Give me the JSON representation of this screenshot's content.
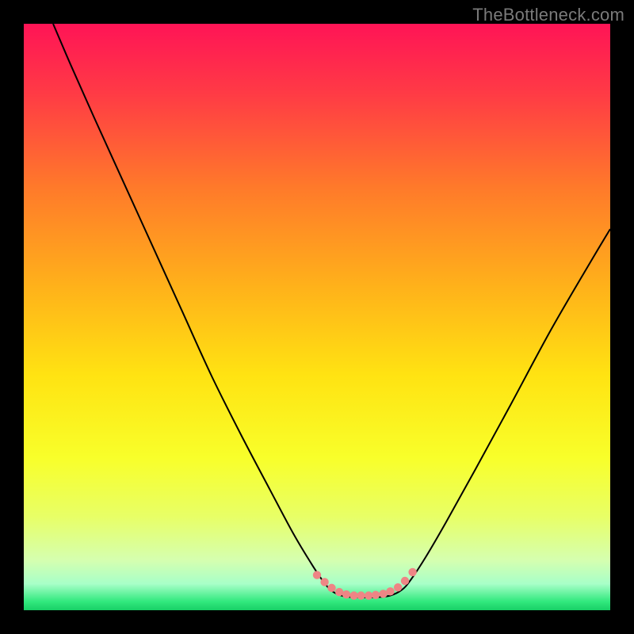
{
  "watermark": "TheBottleneck.com",
  "chart_data": {
    "type": "line",
    "title": "",
    "xlabel": "",
    "ylabel": "",
    "xlim": [
      0,
      100
    ],
    "ylim": [
      0,
      100
    ],
    "background_gradient": {
      "stops": [
        {
          "offset": 0.0,
          "color": "#ff1456"
        },
        {
          "offset": 0.12,
          "color": "#ff3b45"
        },
        {
          "offset": 0.28,
          "color": "#ff7a2a"
        },
        {
          "offset": 0.45,
          "color": "#ffb21a"
        },
        {
          "offset": 0.6,
          "color": "#ffe312"
        },
        {
          "offset": 0.74,
          "color": "#f8ff2a"
        },
        {
          "offset": 0.84,
          "color": "#e8ff66"
        },
        {
          "offset": 0.915,
          "color": "#d5ffb0"
        },
        {
          "offset": 0.955,
          "color": "#a8ffc8"
        },
        {
          "offset": 0.985,
          "color": "#32e97e"
        },
        {
          "offset": 1.0,
          "color": "#18d066"
        }
      ]
    },
    "series": [
      {
        "name": "bottleneck-curve",
        "color": "#000000",
        "width": 2,
        "points": [
          {
            "x": 5.0,
            "y": 100.0
          },
          {
            "x": 8.0,
            "y": 93.0
          },
          {
            "x": 12.0,
            "y": 84.0
          },
          {
            "x": 17.0,
            "y": 73.0
          },
          {
            "x": 22.0,
            "y": 62.0
          },
          {
            "x": 27.0,
            "y": 51.0
          },
          {
            "x": 32.0,
            "y": 40.0
          },
          {
            "x": 37.0,
            "y": 30.0
          },
          {
            "x": 42.0,
            "y": 20.5
          },
          {
            "x": 46.0,
            "y": 13.0
          },
          {
            "x": 49.0,
            "y": 8.0
          },
          {
            "x": 51.0,
            "y": 5.0
          },
          {
            "x": 52.5,
            "y": 3.3
          },
          {
            "x": 54.5,
            "y": 2.4
          },
          {
            "x": 57.0,
            "y": 2.2
          },
          {
            "x": 60.0,
            "y": 2.2
          },
          {
            "x": 62.5,
            "y": 2.5
          },
          {
            "x": 64.5,
            "y": 3.5
          },
          {
            "x": 66.0,
            "y": 5.2
          },
          {
            "x": 68.5,
            "y": 9.0
          },
          {
            "x": 72.0,
            "y": 15.0
          },
          {
            "x": 77.0,
            "y": 24.0
          },
          {
            "x": 83.0,
            "y": 35.0
          },
          {
            "x": 90.0,
            "y": 48.0
          },
          {
            "x": 97.0,
            "y": 60.0
          },
          {
            "x": 100.0,
            "y": 65.0
          }
        ]
      },
      {
        "name": "flat-zone-dots",
        "color": "#ee8585",
        "dot_radius": 5.2,
        "points": [
          {
            "x": 50.0,
            "y": 6.0
          },
          {
            "x": 51.3,
            "y": 4.8
          },
          {
            "x": 52.5,
            "y": 3.8
          },
          {
            "x": 53.8,
            "y": 3.1
          },
          {
            "x": 55.0,
            "y": 2.7
          },
          {
            "x": 56.3,
            "y": 2.5
          },
          {
            "x": 57.5,
            "y": 2.5
          },
          {
            "x": 58.8,
            "y": 2.5
          },
          {
            "x": 60.0,
            "y": 2.6
          },
          {
            "x": 61.3,
            "y": 2.8
          },
          {
            "x": 62.5,
            "y": 3.2
          },
          {
            "x": 63.8,
            "y": 3.9
          },
          {
            "x": 65.0,
            "y": 5.0
          },
          {
            "x": 66.3,
            "y": 6.5
          }
        ]
      }
    ]
  }
}
